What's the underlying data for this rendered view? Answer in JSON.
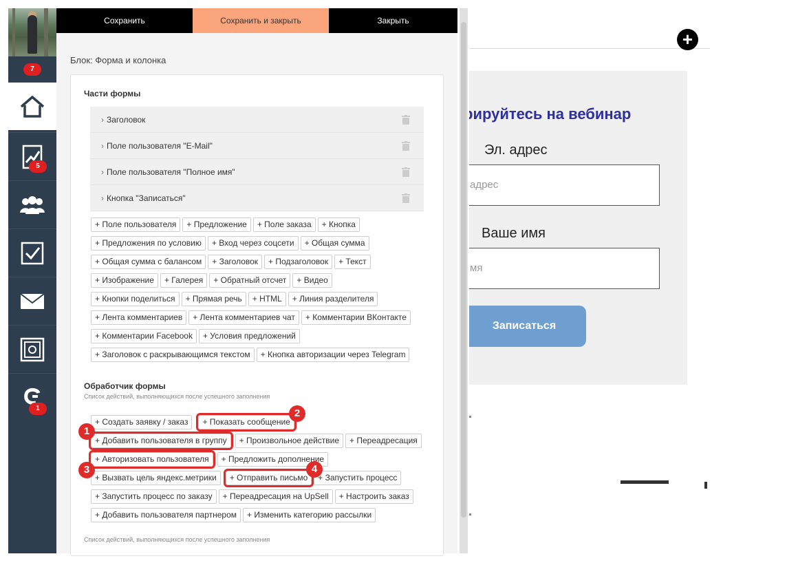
{
  "toolbar": {
    "save_label": "Сохранить",
    "save_close_label": "Сохранить и закрыть",
    "close_label": "Закрыть"
  },
  "sidebar": {
    "avatar_badge": "7",
    "items": [
      {
        "icon": "home-icon",
        "active": true
      },
      {
        "icon": "chart-icon",
        "badge": "5"
      },
      {
        "icon": "users-icon"
      },
      {
        "icon": "checkbox-icon"
      },
      {
        "icon": "mail-icon"
      },
      {
        "icon": "safe-icon"
      },
      {
        "icon": "support-icon",
        "badge": "1"
      }
    ]
  },
  "editor": {
    "block_title": "Блок: Форма и колонка",
    "parts_title": "Части формы",
    "parts": [
      "Заголовок",
      "Поле пользователя \"E-Mail\"",
      "Поле пользователя \"Полное имя\"",
      "Кнопка \"Записаться\""
    ],
    "add_buttons": [
      [
        "+ Поле пользователя",
        "+ Предложение",
        "+ Поле заказа",
        "+ Кнопка"
      ],
      [
        "+ Предложения по условию",
        "+ Вход через соцсети",
        "+ Общая сумма"
      ],
      [
        "+ Общая сумма с балансом",
        "+ Заголовок",
        "+ Подзаголовок",
        "+ Текст"
      ],
      [
        "+ Изображение",
        "+ Галерея",
        "+ Обратный отсчет",
        "+ Видео"
      ],
      [
        "+ Кнопки поделиться",
        "+ Прямая речь",
        "+ HTML",
        "+ Линия разделителя"
      ],
      [
        "+ Лента комментариев",
        "+ Лента комментариев чат",
        "+ Комментарии ВКонтакте"
      ],
      [
        "+ Комментарии Facebook",
        "+ Условия предложений"
      ],
      [
        "+ Заголовок с раскрывающимся текстом",
        "+ Кнопка авторизации через Telegram"
      ]
    ],
    "handler_title": "Обработчик формы",
    "handler_subtitle": "Список действий, выполняющихся после успешного заполнения",
    "handler_buttons": [
      [
        "+ Создать заявку / заказ",
        "+ Показать сообщение"
      ],
      [
        "+ Добавить пользователя в группу",
        "+ Произвольное действие",
        "+ Переадресация"
      ],
      [
        "+ Авторизовать пользователя",
        "+ Предложить дополнение"
      ],
      [
        "+ Вызвать цель яндекс.метрики",
        "+ Отправить письмо",
        "+ Запустить процесс"
      ],
      [
        "+ Запустить процесс по заказу",
        "+ Переадресация на UpSell",
        "+ Настроить заказ"
      ],
      [
        "+ Добавить пользователя партнером",
        "+ Изменить категорию рассылки"
      ]
    ],
    "footer_note": "Список действий, выполняющихся после успешного заполнения"
  },
  "annotations": [
    "1",
    "2",
    "3",
    "4"
  ],
  "preview": {
    "heading": "рируйтесь на вебинар",
    "email_label": "Эл. адрес",
    "email_placeholder": "адрес",
    "name_label": "Ваше имя",
    "name_placeholder": "мя",
    "submit_label": "Записаться"
  },
  "colors": {
    "sidebar": "#2e3e4e",
    "badge": "#e02020",
    "save_close_bg": "#fba57d",
    "highlight": "#e02b2b",
    "preview_heading": "#2d2fa0",
    "submit_bg": "#6f9fd0"
  }
}
